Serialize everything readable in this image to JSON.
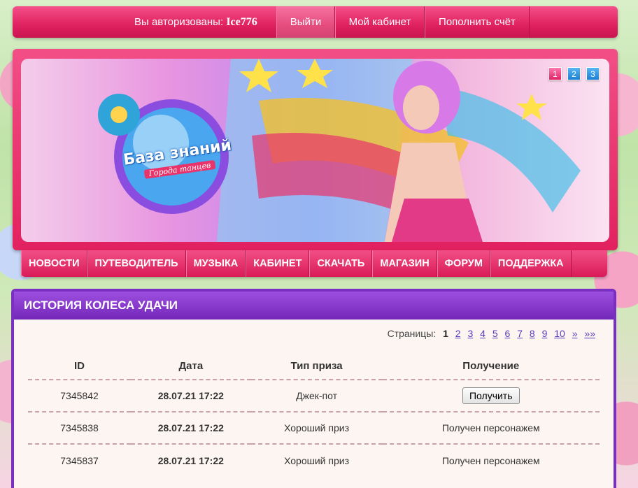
{
  "topbar": {
    "auth_prefix": "Вы авторизованы:",
    "username": "Ice776",
    "logout": "Выйти",
    "cabinet": "Мой кабинет",
    "topup": "Пополнить счёт"
  },
  "banner": {
    "logo_title": "База знаний",
    "logo_subtitle": "Города танцев",
    "slides": [
      "1",
      "2",
      "3"
    ],
    "active_slide": "1"
  },
  "nav": [
    "НОВОСТИ",
    "ПУТЕВОДИТЕЛЬ",
    "МУЗЫКА",
    "КАБИНЕТ",
    "СКАЧАТЬ",
    "МАГАЗИН",
    "ФОРУМ",
    "ПОДДЕРЖКА"
  ],
  "panel": {
    "title": "ИСТОРИЯ КОЛЕСА УДАЧИ",
    "pager_label": "Страницы:",
    "pages": [
      "1",
      "2",
      "3",
      "4",
      "5",
      "6",
      "7",
      "8",
      "9",
      "10",
      "»",
      "»»"
    ],
    "current_page": "1",
    "columns": [
      "ID",
      "Дата",
      "Тип приза",
      "Получение"
    ],
    "rows": [
      {
        "id": "7345842",
        "date": "28.07.21 17:22",
        "type": "Джек-пот",
        "status": "Получить",
        "is_button": true
      },
      {
        "id": "7345838",
        "date": "28.07.21 17:22",
        "type": "Хороший приз",
        "status": "Получен персонажем",
        "is_button": false
      },
      {
        "id": "7345837",
        "date": "28.07.21 17:22",
        "type": "Хороший приз",
        "status": "Получен персонажем",
        "is_button": false
      }
    ]
  },
  "colors": {
    "accent_pink": "#e2215f",
    "panel_purple": "#7b2ec2",
    "link": "#5a3ab8"
  }
}
